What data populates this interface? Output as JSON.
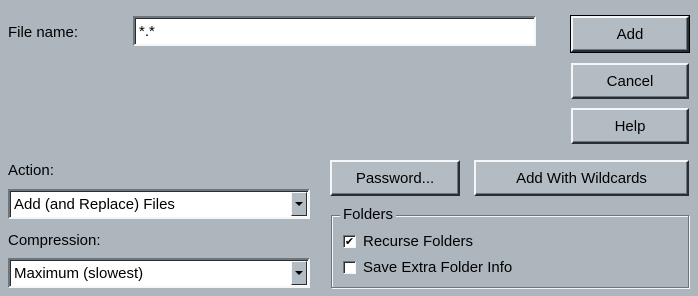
{
  "file_name": {
    "label": "File name:",
    "value": "*.*"
  },
  "buttons": {
    "add": "Add",
    "cancel": "Cancel",
    "help": "Help",
    "password": "Password...",
    "add_with_wildcards": "Add With Wildcards"
  },
  "action": {
    "label": "Action:",
    "selected": "Add (and Replace) Files"
  },
  "compression": {
    "label": "Compression:",
    "selected": "Maximum (slowest)"
  },
  "folders": {
    "title": "Folders",
    "recurse": {
      "label": "Recurse Folders",
      "checked": true
    },
    "save_extra": {
      "label": "Save Extra Folder Info",
      "checked": false
    }
  },
  "icons": {
    "dropdown": "chevron-down-icon",
    "check": "checkmark-icon"
  }
}
